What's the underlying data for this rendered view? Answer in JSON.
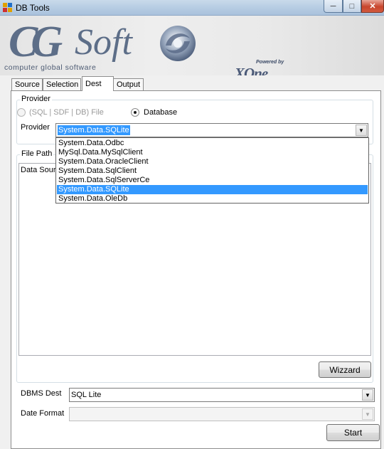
{
  "window": {
    "title": "DB Tools",
    "minimize_glyph": "─",
    "maximize_glyph": "□",
    "close_glyph": "✕"
  },
  "banner": {
    "logo_cg": "CG",
    "logo_soft": "Soft",
    "logo_sub": "computer global software",
    "powered_by": "Powered by",
    "xone": "XOne"
  },
  "tabs": [
    {
      "label": "Source",
      "active": false
    },
    {
      "label": "Selection",
      "active": false
    },
    {
      "label": "Dest",
      "active": true
    },
    {
      "label": "Output",
      "active": false
    }
  ],
  "provider_group": {
    "legend": "Provider",
    "radio_file_label": "(SQL | SDF | DB) File",
    "radio_file_enabled": false,
    "radio_db_label": "Database",
    "radio_db_checked": true,
    "provider_label": "Provider",
    "provider_value": "System.Data.SQLite"
  },
  "provider_dropdown": {
    "options": [
      "System.Data.Odbc",
      "MySql.Data.MySqlClient",
      "System.Data.OracleClient",
      "System.Data.SqlClient",
      "System.Data.SqlServerCe",
      "System.Data.SQLite",
      "System.Data.OleDb"
    ],
    "selected_index": 5
  },
  "filepath_group": {
    "legend": "File Path",
    "datasource_text": "Data Sour"
  },
  "buttons": {
    "wizzard": "Wizzard",
    "start": "Start"
  },
  "dbms": {
    "label": "DBMS Dest",
    "value": "SQL Lite"
  },
  "date_format": {
    "label": "Date Format",
    "value": ""
  },
  "icons": {
    "combo_arrow": "▼"
  },
  "colors": {
    "selection": "#3399ff",
    "close_button": "#c8452c"
  }
}
